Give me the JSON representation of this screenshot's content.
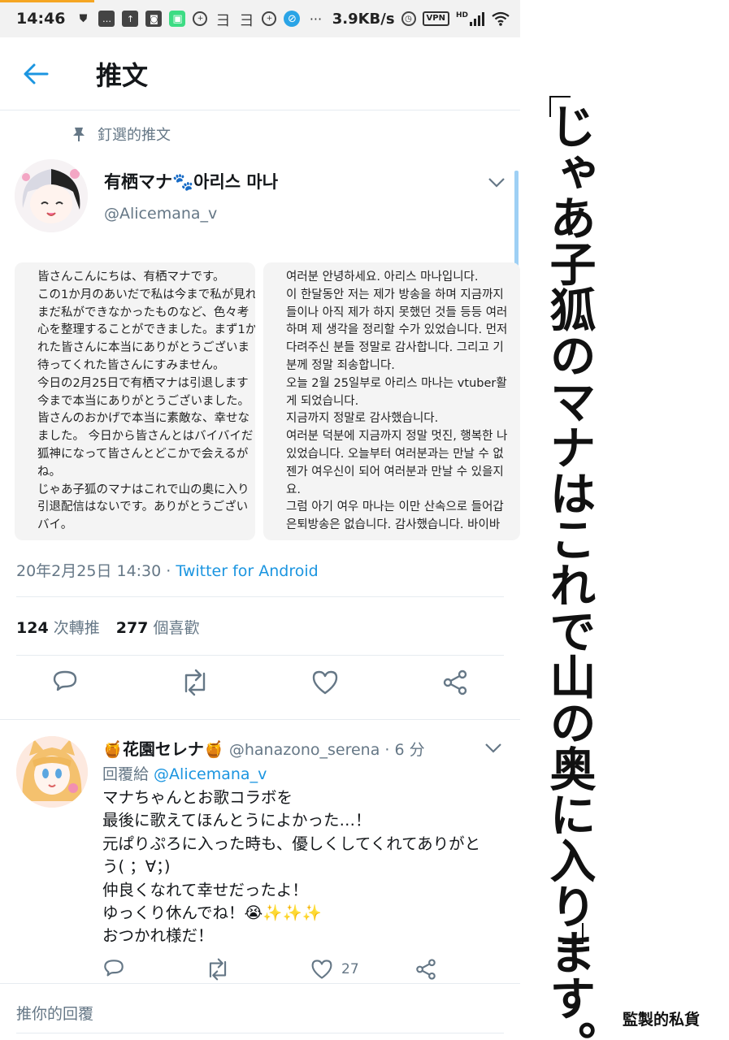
{
  "status_bar": {
    "time": "14:46",
    "net_speed": "3.9KB/s",
    "vpn": "VPN",
    "network_type": "HD"
  },
  "nav": {
    "title": "推文"
  },
  "pinned_label": "釘選的推文",
  "tweet": {
    "author_name": "有栖マナ🐾아리스 마나",
    "author_handle": "@Alicemana_v",
    "image_jp_lines": [
      "皆さんこんにちは、有栖マナです。",
      "この1か月のあいだで私は今まで私が見れ",
      "まだ私ができなかったものなど、色々考",
      "心を整理することができました。まず1か",
      "れた皆さんに本当にありがとうございま",
      "待ってくれた皆さんにすみません。",
      "今日の2月25日で有栖マナは引退します",
      "今まで本当にありがとうございました。",
      "皆さんのおかげで本当に素敵な、幸せな",
      "ました。 今日から皆さんとはバイバイだ",
      "狐神になって皆さんとどこかで会えるが",
      "ね。",
      "じゃあ子狐のマナはこれで山の奥に入り",
      "引退配信はないです。ありがとうござい",
      "バイ。"
    ],
    "image_kr_lines": [
      "여러분 안녕하세요. 아리스 마나입니다.",
      "이 한달동안 저는 제가 방송을 하며 지금까지",
      "들이나 아직 제가 하지 못했던 것들 등등 여러",
      "하며 제 생각을 정리할 수가 있었습니다. 먼저",
      "다려주신 분들 정말로 감사합니다. 그리고 기",
      "분께 정말 죄송합니다.",
      "오늘 2월 25일부로 아리스 마나는 vtuber활",
      "게 되었습니다.",
      "지금까지 정말로 감사했습니다.",
      "여러분 덕분에 지금까지 정말 멋진, 행복한 나",
      "있었습니다. 오늘부터 여러분과는 만날 수 없",
      "젠가 여우신이 되어 여러분과 만날 수 있을지",
      "요.",
      "그럼 아기 여우 마나는 이만 산속으로 들어갑",
      "은퇴방송은 없습니다. 감사했습니다. 바이바"
    ],
    "timestamp": "20年2月25日 14:30 · ",
    "source": "Twitter for Android",
    "retweet_count": "124",
    "retweet_label": "次轉推",
    "like_count": "277",
    "like_label": "個喜歡"
  },
  "reply": {
    "author_name": "🍯花園セレナ🍯",
    "author_handle": "@hanazono_serena",
    "time_ago": "· 6 分",
    "reply_prefix": "回覆給 ",
    "reply_to": "@Alicemana_v",
    "text_lines": [
      "マナちゃんとお歌コラボを",
      "最後に歌えてほんとうによかった…！",
      "元ぱりぷろに入った時も、優しくしてくれてありがと",
      "う( ；∀；)",
      "仲良くなれて幸せだったよ！",
      "ゆっくり休んでね！😭✨✨✨",
      "おつかれ様だ！"
    ],
    "like_count": "27"
  },
  "composer": {
    "placeholder": "推你的回覆"
  },
  "caption": {
    "vertical_text": "じゃあ子狐のマナはこれで山の奥に入ります。",
    "credit": "監製的私貨"
  },
  "colors": {
    "accent": "#1b95e0",
    "secondary_text": "#657786",
    "divider": "#e6ecf0"
  },
  "icons": [
    "back-arrow-icon",
    "pin-icon",
    "chevron-down-icon",
    "reply-icon",
    "retweet-icon",
    "like-icon",
    "share-icon"
  ]
}
